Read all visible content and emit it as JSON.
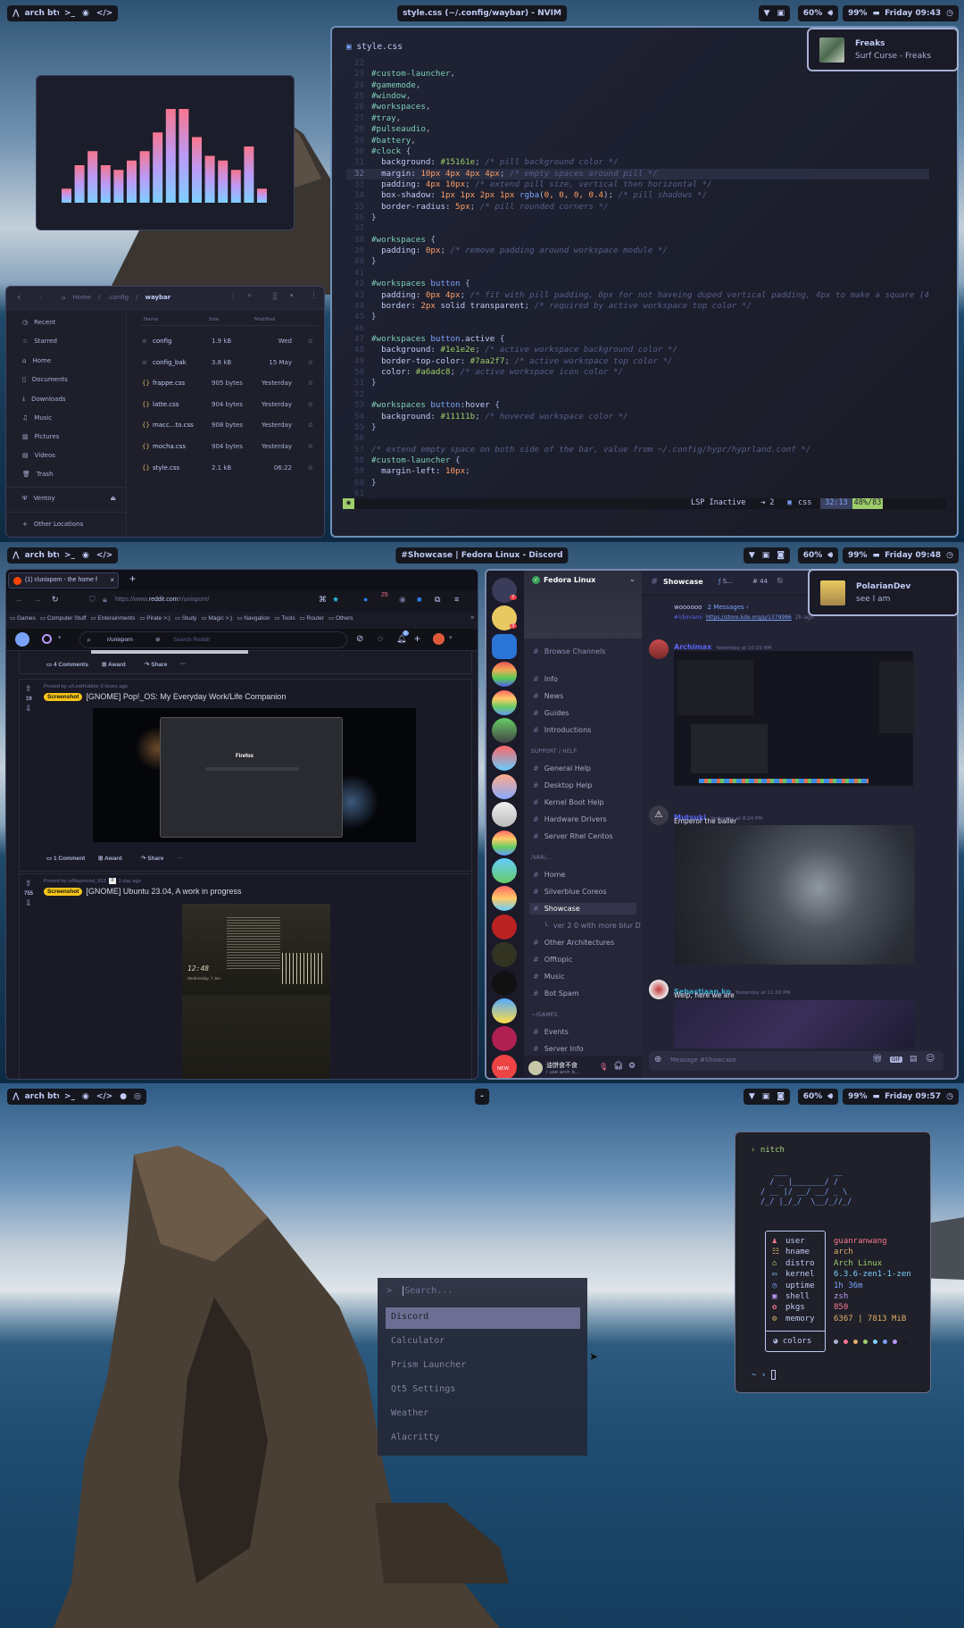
{
  "screens": [
    {
      "bar": {
        "launcher": "arch btw",
        "workspaces": [
          "terminal",
          "chrome",
          "code"
        ],
        "title": "style.css (~/.config/waybar) - NVIM",
        "volume": "60%",
        "battery": "99%",
        "clock": "Friday 09:43"
      }
    },
    {
      "bar": {
        "launcher": "arch btw",
        "workspaces": [
          "terminal",
          "chrome",
          "code"
        ],
        "title": "#Showcase | Fedora Linux - Discord",
        "volume": "60%",
        "battery": "99%",
        "clock": "Friday 09:48"
      }
    },
    {
      "bar": {
        "launcher": "arch btw",
        "workspaces": [
          "terminal",
          "chrome",
          "code",
          "discord",
          "obs"
        ],
        "title": "-",
        "volume": "60%",
        "battery": "99%",
        "clock": "Friday 09:57"
      }
    }
  ],
  "colors": {
    "accent": "#7aa2f7",
    "bg": "#1a1b26",
    "green": "#9ece6a"
  },
  "cava": {
    "levels": [
      0.15,
      0.4,
      0.55,
      0.4,
      0.35,
      0.45,
      0.55,
      0.75,
      1.0,
      1.0,
      0.7,
      0.5,
      0.45,
      0.35,
      0.6,
      0.15
    ]
  },
  "music_notification": {
    "title": "Freaks",
    "body": "Surf Curse - Freaks"
  },
  "nvim": {
    "filename": "style.css",
    "current_line": 32,
    "lines": [
      {
        "n": 22,
        "s": []
      },
      {
        "n": 23,
        "s": [
          [
            "sel",
            "#custom-launcher"
          ],
          [
            "p",
            ","
          ]
        ]
      },
      {
        "n": 24,
        "s": [
          [
            "sel",
            "#gamemode"
          ],
          [
            "p",
            ","
          ]
        ]
      },
      {
        "n": 25,
        "s": [
          [
            "sel",
            "#window"
          ],
          [
            "p",
            ","
          ]
        ]
      },
      {
        "n": 26,
        "s": [
          [
            "sel",
            "#workspaces"
          ],
          [
            "p",
            ","
          ]
        ]
      },
      {
        "n": 27,
        "s": [
          [
            "sel",
            "#tray"
          ],
          [
            "p",
            ","
          ]
        ]
      },
      {
        "n": 28,
        "s": [
          [
            "sel",
            "#pulseaudio"
          ],
          [
            "p",
            ","
          ]
        ]
      },
      {
        "n": 29,
        "s": [
          [
            "sel",
            "#battery"
          ],
          [
            "p",
            ","
          ]
        ]
      },
      {
        "n": 30,
        "s": [
          [
            "sel",
            "#clock"
          ],
          [
            "p",
            " {"
          ]
        ]
      },
      {
        "n": 31,
        "s": [
          [
            "prop",
            "  background: "
          ],
          [
            "hex",
            "#15161e"
          ],
          [
            "p",
            "; "
          ],
          [
            "com",
            "/* pill background color */"
          ]
        ]
      },
      {
        "n": 32,
        "s": [
          [
            "prop",
            "  margin: "
          ],
          [
            "num",
            "10px 4px 4px 4px"
          ],
          [
            "p",
            "; "
          ],
          [
            "com",
            "/* empty spaces around pill */"
          ]
        ]
      },
      {
        "n": 33,
        "s": [
          [
            "prop",
            "  padding: "
          ],
          [
            "num",
            "4px 10px"
          ],
          [
            "p",
            "; "
          ],
          [
            "com",
            "/* extend pill size, vertical then horizontal */"
          ]
        ]
      },
      {
        "n": 34,
        "s": [
          [
            "prop",
            "  box-shadow: "
          ],
          [
            "num",
            "1px 1px 2px 1px "
          ],
          [
            "fn",
            "rgba"
          ],
          [
            "p",
            "("
          ],
          [
            "num",
            "0, 0, 0, 0.4"
          ],
          [
            "p",
            "); "
          ],
          [
            "com",
            "/* pill shadows */"
          ]
        ]
      },
      {
        "n": 35,
        "s": [
          [
            "prop",
            "  border-radius: "
          ],
          [
            "num",
            "5px"
          ],
          [
            "p",
            "; "
          ],
          [
            "com",
            "/* pill rounded corners */"
          ]
        ]
      },
      {
        "n": 36,
        "s": [
          [
            "p",
            "}"
          ]
        ]
      },
      {
        "n": 37,
        "s": []
      },
      {
        "n": 38,
        "s": [
          [
            "sel",
            "#workspaces"
          ],
          [
            "p",
            " {"
          ]
        ]
      },
      {
        "n": 39,
        "s": [
          [
            "prop",
            "  padding: "
          ],
          [
            "num",
            "0px"
          ],
          [
            "p",
            "; "
          ],
          [
            "com",
            "/* remove padding around workspace module */"
          ]
        ]
      },
      {
        "n": 40,
        "s": [
          [
            "p",
            "}"
          ]
        ]
      },
      {
        "n": 41,
        "s": []
      },
      {
        "n": 42,
        "s": [
          [
            "sel",
            "#workspaces "
          ],
          [
            "sel2",
            "button"
          ],
          [
            "p",
            " {"
          ]
        ]
      },
      {
        "n": 43,
        "s": [
          [
            "prop",
            "  padding: "
          ],
          [
            "num",
            "0px 4px"
          ],
          [
            "p",
            "; "
          ],
          [
            "com",
            "/* fit with pill padding, 0px for not haveing duped vertical padding, 4px to make a square (4"
          ]
        ]
      },
      {
        "n": 44,
        "s": [
          [
            "prop",
            "  border: "
          ],
          [
            "num",
            "2px"
          ],
          [
            "prop",
            " solid transparent"
          ],
          [
            "p",
            "; "
          ],
          [
            "com",
            "/* required by active workspace top color */"
          ]
        ]
      },
      {
        "n": 45,
        "s": [
          [
            "p",
            "}"
          ]
        ]
      },
      {
        "n": 46,
        "s": []
      },
      {
        "n": 47,
        "s": [
          [
            "sel",
            "#workspaces "
          ],
          [
            "sel2",
            "button"
          ],
          [
            "prop",
            ".active"
          ],
          [
            "p",
            " {"
          ]
        ]
      },
      {
        "n": 48,
        "s": [
          [
            "prop",
            "  background: "
          ],
          [
            "hex",
            "#1e1e2e"
          ],
          [
            "p",
            "; "
          ],
          [
            "com",
            "/* active workspace background color */"
          ]
        ]
      },
      {
        "n": 49,
        "s": [
          [
            "prop",
            "  border-top-color: "
          ],
          [
            "hex",
            "#7aa2f7"
          ],
          [
            "p",
            "; "
          ],
          [
            "com",
            "/* active workspace top color */"
          ]
        ]
      },
      {
        "n": 50,
        "s": [
          [
            "prop",
            "  color: "
          ],
          [
            "hex",
            "#a6adc8"
          ],
          [
            "p",
            "; "
          ],
          [
            "com",
            "/* active workspace icon color */"
          ]
        ]
      },
      {
        "n": 51,
        "s": [
          [
            "p",
            "}"
          ]
        ]
      },
      {
        "n": 52,
        "s": []
      },
      {
        "n": 53,
        "s": [
          [
            "sel",
            "#workspaces "
          ],
          [
            "sel2",
            "button"
          ],
          [
            "prop",
            ":hover"
          ],
          [
            "p",
            " {"
          ]
        ]
      },
      {
        "n": 54,
        "s": [
          [
            "prop",
            "  background: "
          ],
          [
            "hex",
            "#11111b"
          ],
          [
            "p",
            "; "
          ],
          [
            "com",
            "/* hovered workspace color */"
          ]
        ]
      },
      {
        "n": 55,
        "s": [
          [
            "p",
            "}"
          ]
        ]
      },
      {
        "n": 56,
        "s": []
      },
      {
        "n": 57,
        "s": [
          [
            "com",
            "/* extend empty space on both side of the bar, value from ~/.config/hypr/hyprland.conf */"
          ]
        ]
      },
      {
        "n": 58,
        "s": [
          [
            "sel",
            "#custom-launcher"
          ],
          [
            "p",
            " {"
          ]
        ]
      },
      {
        "n": 59,
        "s": [
          [
            "prop",
            "  margin-left: "
          ],
          [
            "num",
            "10px"
          ],
          [
            "p",
            ";"
          ]
        ]
      },
      {
        "n": 60,
        "s": [
          [
            "p",
            "}"
          ]
        ]
      },
      {
        "n": 61,
        "s": []
      }
    ],
    "status": {
      "lsp": "LSP Inactive",
      "indent": "⇥ 2",
      "filetype": "css",
      "position": "32:13",
      "progress": "48%/83"
    }
  },
  "files": {
    "breadcrumb": [
      "Home",
      ".config",
      "waybar"
    ],
    "sidebar": [
      {
        "icon": "clock",
        "label": "Recent"
      },
      {
        "icon": "star",
        "label": "Starred"
      },
      {
        "icon": "home",
        "label": "Home"
      },
      {
        "icon": "document",
        "label": "Documents"
      },
      {
        "icon": "download",
        "label": "Downloads"
      },
      {
        "icon": "music",
        "label": "Music"
      },
      {
        "icon": "picture",
        "label": "Pictures"
      },
      {
        "icon": "video",
        "label": "Videos"
      },
      {
        "icon": "trash",
        "label": "Trash"
      }
    ],
    "devices": [
      {
        "label": "Ventoy"
      }
    ],
    "other": "Other Locations",
    "columns": {
      "name": "Name",
      "size": "Size",
      "modified": "Modified"
    },
    "rows": [
      {
        "name": "config",
        "size": "1.9 kB",
        "modified": "Wed",
        "type": "text"
      },
      {
        "name": "config_bak",
        "size": "3.8 kB",
        "modified": "15 May",
        "type": "text"
      },
      {
        "name": "frappe.css",
        "size": "905 bytes",
        "modified": "Yesterday",
        "type": "css"
      },
      {
        "name": "latte.css",
        "size": "904 bytes",
        "modified": "Yesterday",
        "type": "css"
      },
      {
        "name": "macc...to.css",
        "size": "908 bytes",
        "modified": "Yesterday",
        "type": "css"
      },
      {
        "name": "mocha.css",
        "size": "904 bytes",
        "modified": "Yesterday",
        "type": "css"
      },
      {
        "name": "style.css",
        "size": "2.1 kB",
        "modified": "06:22",
        "type": "css"
      }
    ]
  },
  "browser": {
    "tab": "(1) r/unixporn - the home f",
    "url_prefix": "https://www.",
    "url_domain": "reddit.com",
    "url_path": "/r/unixporn/",
    "bookmarks": [
      "Games",
      "Computer Stuff",
      "Enterainments",
      "Pirate >:)",
      "Study",
      "Magic >:)",
      "Navgation",
      "Tools",
      "Router",
      "Others"
    ],
    "ext_badge": "25",
    "community": "r/unixporn",
    "search_placeholder": "Search Reddit",
    "notif_count": "1",
    "first_actions": {
      "comments": "4 Comments",
      "award": "Award",
      "share": "Share"
    },
    "posts": [
      {
        "meta": "Posted by u/LeafHubble 9 hours ago",
        "votes": "19",
        "flair": "Screenshot",
        "title": "[GNOME] Pop!_OS: My Everyday Work/Life Companion",
        "preview_label": "Firefox",
        "comments": "1 Comment",
        "award": "Award",
        "share": "Share"
      },
      {
        "meta": "Posted by u/Raymond_912",
        "meta_time": "1 day ago",
        "votes": "755",
        "flair": "Screenshot",
        "title": "[GNOME] Ubuntu 23.04, A work in progress",
        "preview_clock": "12:48",
        "preview_date": "Wednesday, 7 Jun"
      }
    ]
  },
  "discord": {
    "server": "Fedora Linux",
    "badges": [
      "7",
      "3"
    ],
    "browse": "Browse Channels",
    "channels": [
      {
        "type": "channel",
        "label": "Info"
      },
      {
        "type": "channel",
        "label": "News"
      },
      {
        "type": "channel",
        "label": "Guides"
      },
      {
        "type": "channel",
        "label": "Introductions"
      },
      {
        "type": "category",
        "label": "SUPPORT / HELP"
      },
      {
        "type": "channel",
        "label": "General Help"
      },
      {
        "type": "channel",
        "label": "Desktop Help"
      },
      {
        "type": "channel",
        "label": "Kernel Boot Help"
      },
      {
        "type": "channel",
        "label": "Hardware Drivers"
      },
      {
        "type": "channel",
        "label": "Server Rhel Centos"
      },
      {
        "type": "category",
        "label": "/VAR/..."
      },
      {
        "type": "channel",
        "label": "Home"
      },
      {
        "type": "channel",
        "label": "Silverblue Coreos"
      },
      {
        "type": "channel",
        "label": "Showcase",
        "active": true
      },
      {
        "type": "thread",
        "label": "ver 2 0 with more blur D"
      },
      {
        "type": "channel",
        "label": "Other Architectures"
      },
      {
        "type": "channel",
        "label": "Offtopic"
      },
      {
        "type": "channel",
        "label": "Music"
      },
      {
        "type": "channel",
        "label": "Bot Spam"
      },
      {
        "type": "category",
        "label": "~/GAMES"
      },
      {
        "type": "channel",
        "label": "Events"
      },
      {
        "type": "channel",
        "label": "Server Info"
      }
    ],
    "user": {
      "name": "油饼食不食",
      "status": "i use arch b..."
    },
    "new_badge": "NEW",
    "header": {
      "channel": "Showcase",
      "thread": "S...",
      "threads_count": "44"
    },
    "thread_preview": {
      "name": "woooooo",
      "messages": "2 Messages ›",
      "channel": "#!/bin/ami",
      "link": "https://store.kde.org/p/1379986",
      "time": "2h ago"
    },
    "messages": [
      {
        "author": "Archimax",
        "color": "#5865f2",
        "time": "Yesterday at 10:10 AM",
        "text": ""
      },
      {
        "author": "Mutsuki",
        "color": "#5865f2",
        "time": "Yesterday at 8:24 PM",
        "text": "Emperor the baller"
      },
      {
        "author": "Sebastiaan.ko",
        "color": "#3ba7c9",
        "time": "Yesterday at 11:00 PM",
        "text": "Welp, here we are"
      }
    ],
    "input_placeholder": "Message #Showcase",
    "gif": "GIF"
  },
  "discord_notification": {
    "title": "PolarianDev",
    "body": "see I am"
  },
  "launcher": {
    "prompt": ">",
    "placeholder": "Search...",
    "items": [
      "Discord",
      "Calculator",
      "Prism Launcher",
      "Qt5 Settings",
      "Weather",
      "Alacritty"
    ],
    "selected": 0
  },
  "nitch": {
    "command": "nitch",
    "ascii": [
      "   ___          __",
      "  / _ |_______/ /",
      "/ __ |/ __/ __/ _ \\",
      "/_/ |_/_/  \\__/_//_/"
    ],
    "rows": [
      {
        "icon": "user",
        "key": "user",
        "value": "guanranwang",
        "color": "#f7768e"
      },
      {
        "icon": "hname",
        "key": "hname",
        "value": "arch",
        "color": "#e0af68"
      },
      {
        "icon": "distro",
        "key": "distro",
        "value": "Arch Linux",
        "color": "#9ece6a"
      },
      {
        "icon": "kernel",
        "key": "kernel",
        "value": "6.3.6-zen1-1-zen",
        "color": "#7dcfff"
      },
      {
        "icon": "uptime",
        "key": "uptime",
        "value": "1h 36m",
        "color": "#7aa2f7"
      },
      {
        "icon": "shell",
        "key": "shell",
        "value": "zsh",
        "color": "#bb9af7"
      },
      {
        "icon": "pkgs",
        "key": "pkgs",
        "value": "850",
        "color": "#f7768e"
      },
      {
        "icon": "memory",
        "key": "memory",
        "value": "6367 | 7813 MiB",
        "color": "#e0af68"
      }
    ],
    "colors_label": "colors",
    "palette": [
      "#a9b1d6",
      "#f7768e",
      "#e0af68",
      "#9ece6a",
      "#7dcfff",
      "#7aa2f7",
      "#bb9af7",
      "#1a1b26"
    ],
    "prompt": "~ ›"
  }
}
